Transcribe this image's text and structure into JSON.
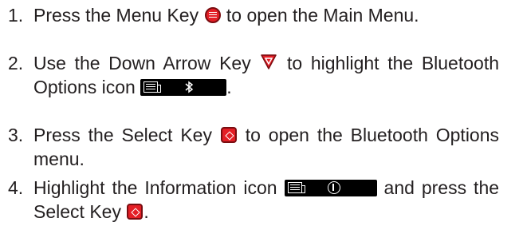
{
  "steps": [
    {
      "number": "1.",
      "part1": "Press the Menu Key",
      "part2": "to open the Main Menu."
    },
    {
      "number": "2.",
      "part1": "Use the Down Arrow Key",
      "part2": "to highlight the Bluetooth Options icon",
      "part3": "."
    },
    {
      "number": "3.",
      "part1": "Press the Select Key",
      "part2": "to open the Bluetooth Options menu."
    },
    {
      "number": "4.",
      "part1": "Highlight the Information icon",
      "part2": "and press the Select Key",
      "part3": "."
    }
  ],
  "icons": {
    "menu_key": "menu-key-icon",
    "down_arrow_key": "down-arrow-key-icon",
    "select_key": "select-key-icon",
    "bluetooth_options": "bluetooth-options-icon",
    "information": "information-icon"
  },
  "colors": {
    "key_red": "#e41e25",
    "icon_bar": "#000000",
    "text": "#231f20"
  }
}
